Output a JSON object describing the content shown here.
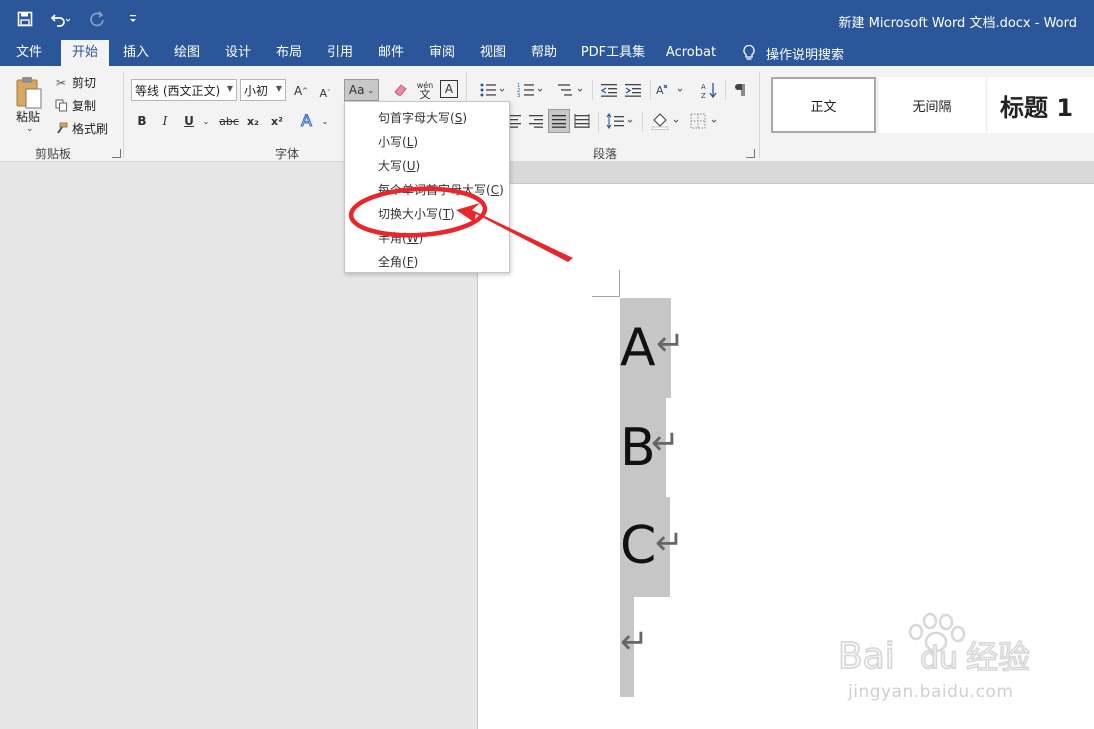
{
  "window": {
    "title": "新建 Microsoft Word 文档.docx  -  Word"
  },
  "quick_access": {
    "icons": [
      "save-icon",
      "undo-icon",
      "redo-icon",
      "customize-icon"
    ]
  },
  "tabs": [
    "文件",
    "开始",
    "插入",
    "绘图",
    "设计",
    "布局",
    "引用",
    "邮件",
    "审阅",
    "视图",
    "帮助",
    "PDF工具集",
    "Acrobat"
  ],
  "active_tab": "开始",
  "tell_me": "操作说明搜索",
  "clipboard": {
    "paste": "粘贴",
    "cut": "剪切",
    "copy": "复制",
    "format_painter": "格式刷",
    "group_label": "剪贴板"
  },
  "font": {
    "name": "等线 (西文正文)",
    "size": "小初",
    "change_case_label": "Aa",
    "grow": "A",
    "shrink": "A",
    "bold": "B",
    "italic": "I",
    "underline": "U",
    "strike": "abc",
    "sub": "x₂",
    "sup": "x²",
    "phonetic": "wén",
    "group_label": "字体"
  },
  "paragraph": {
    "group_label": "段落"
  },
  "styles": {
    "items": [
      "正文",
      "无间隔",
      "标题 1"
    ]
  },
  "change_case_menu": {
    "items": [
      {
        "label": "句首字母大写",
        "key": "S"
      },
      {
        "label": "小写",
        "key": "L"
      },
      {
        "label": "大写",
        "key": "U"
      },
      {
        "label": "每个单词首字母大写",
        "key": "C"
      },
      {
        "label": "切换大小写",
        "key": "T"
      },
      {
        "label": "半角",
        "key": "W"
      },
      {
        "label": "全角",
        "key": "F"
      }
    ]
  },
  "document": {
    "lines": [
      "A",
      "B",
      "C",
      ""
    ],
    "paragraph_mark": "↵"
  },
  "annotation": {
    "color": "#e8262b",
    "target": "切换大小写"
  },
  "watermark": {
    "logo": "Bai du 经验",
    "url": "jingyan.baidu.com"
  },
  "colors": {
    "titlebar": "#2b579a",
    "ribbon": "#f3f3f3",
    "selection": "#c6c6c6"
  }
}
